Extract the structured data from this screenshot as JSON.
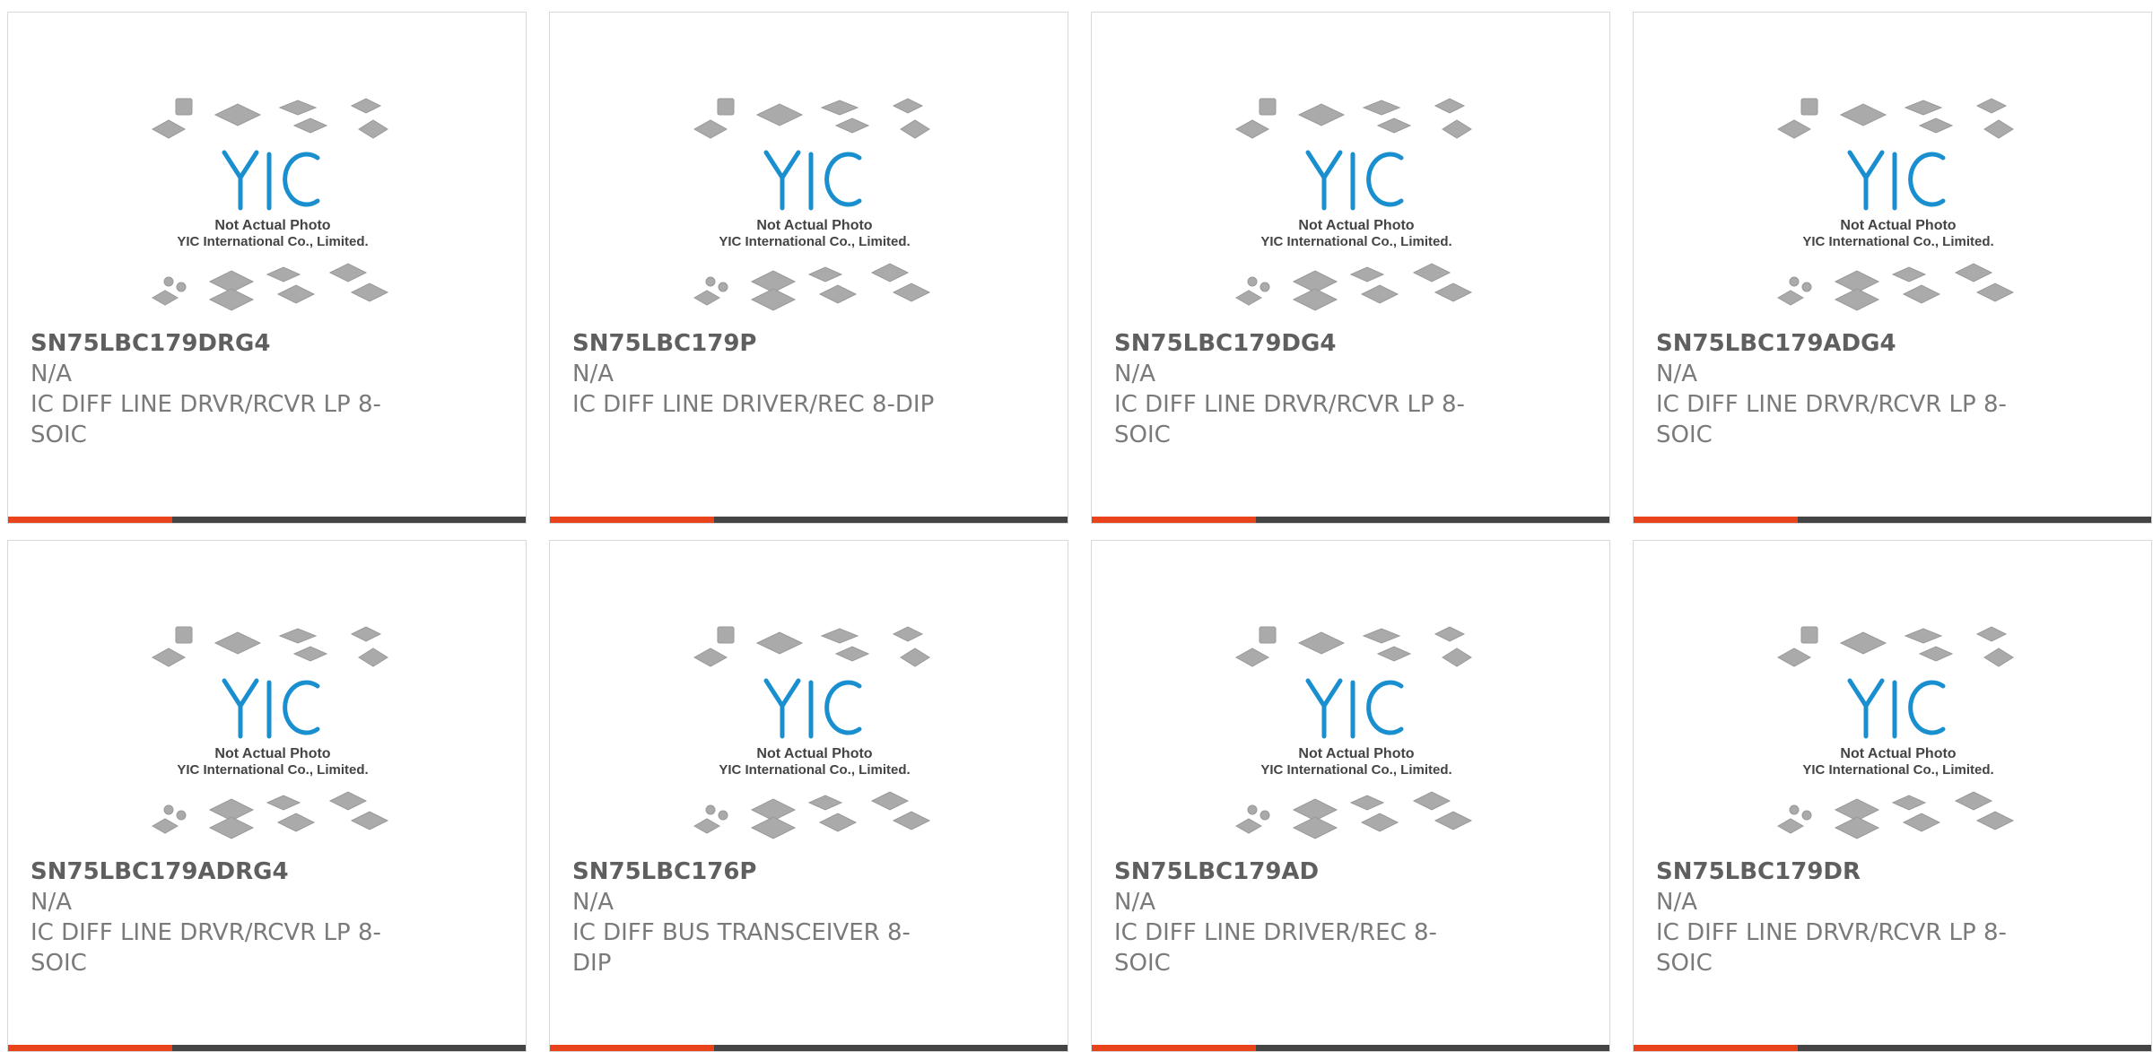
{
  "colors": {
    "accent": "#e8431b",
    "bar": "#444444",
    "logo": "#1a8fd0"
  },
  "placeholder": {
    "line1": "Not Actual Photo",
    "line2": "YIC International Co., Limited.",
    "logo_text": "YIC"
  },
  "products": [
    {
      "part_number": "SN75LBC179DRG4",
      "manufacturer": "N/A",
      "description": "IC DIFF LINE DRVR/RCVR LP 8-SOIC"
    },
    {
      "part_number": "SN75LBC179P",
      "manufacturer": "N/A",
      "description": "IC DIFF LINE DRIVER/REC 8-DIP"
    },
    {
      "part_number": "SN75LBC179DG4",
      "manufacturer": "N/A",
      "description": "IC DIFF LINE DRVR/RCVR LP 8-SOIC"
    },
    {
      "part_number": "SN75LBC179ADG4",
      "manufacturer": "N/A",
      "description": "IC DIFF LINE DRVR/RCVR LP 8-SOIC"
    },
    {
      "part_number": "SN75LBC179ADRG4",
      "manufacturer": "N/A",
      "description": "IC DIFF LINE DRVR/RCVR LP 8-SOIC"
    },
    {
      "part_number": "SN75LBC176P",
      "manufacturer": "N/A",
      "description": "IC DIFF BUS TRANSCEIVER 8-DIP"
    },
    {
      "part_number": "SN75LBC179AD",
      "manufacturer": "N/A",
      "description": "IC DIFF LINE DRIVER/REC 8-SOIC"
    },
    {
      "part_number": "SN75LBC179DR",
      "manufacturer": "N/A",
      "description": "IC DIFF LINE DRVR/RCVR LP 8-SOIC"
    }
  ]
}
